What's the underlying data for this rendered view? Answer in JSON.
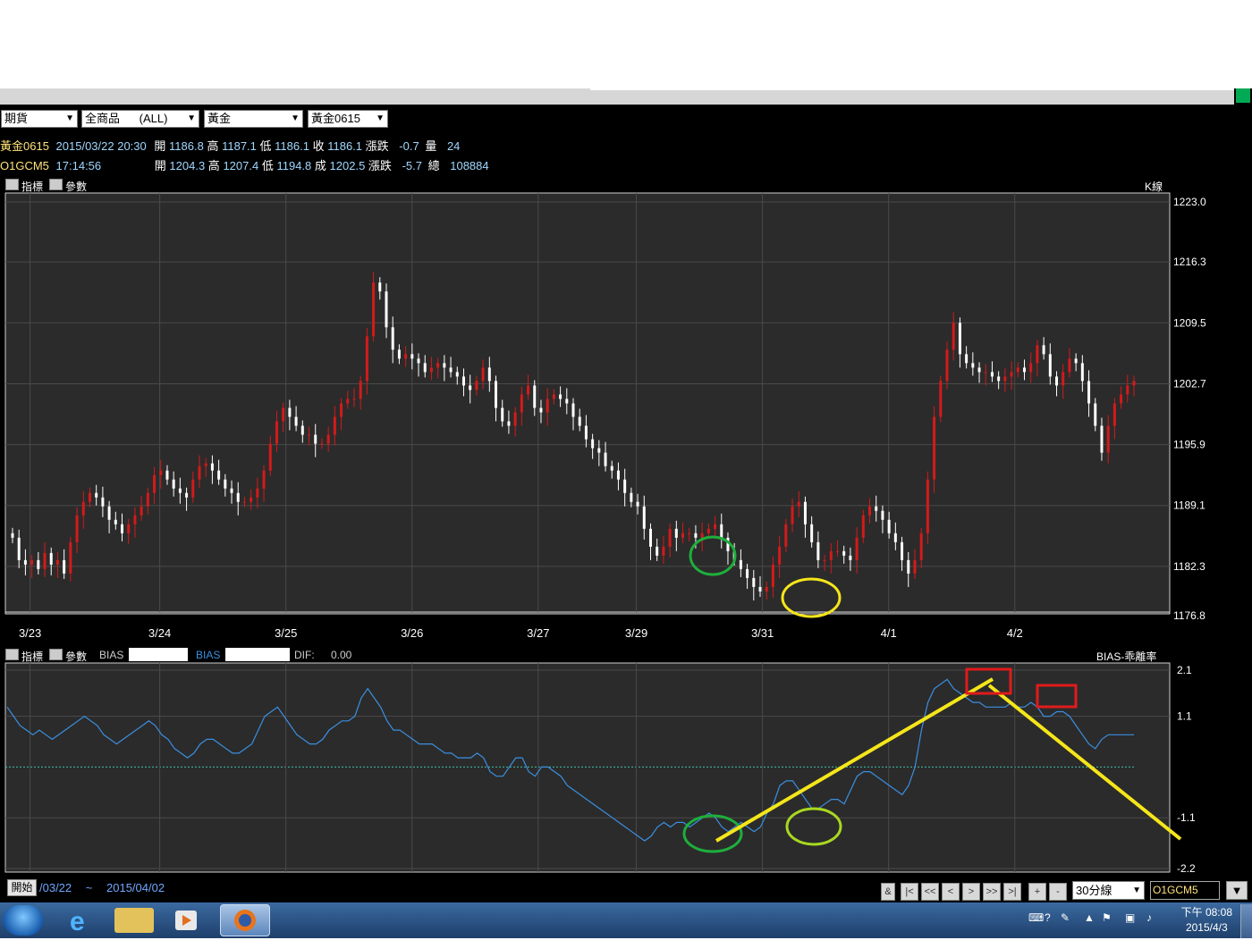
{
  "toolbar": {
    "market_select": "期貨",
    "product_select": "全商品      (ALL)",
    "category_select": "黃金",
    "contract_select": "黃金0615"
  },
  "quote1": {
    "name": "黃金0615",
    "datetime": "2015/03/22 20:30",
    "open_label": "開",
    "open": "1186.8",
    "high_label": "高",
    "high": "1187.1",
    "low_label": "低",
    "low": "1186.1",
    "close_label": "收",
    "close": "1186.1",
    "change_label": "漲跌",
    "change": "-0.7",
    "vol_label": "量",
    "vol": "24"
  },
  "quote2": {
    "name": "O1GCM5",
    "time": "17:14:56",
    "open_label": "開",
    "open": "1204.3",
    "high_label": "高",
    "high": "1207.4",
    "low_label": "低",
    "low": "1194.8",
    "last_label": "成",
    "last": "1202.5",
    "change_label": "漲跌",
    "change": "-5.7",
    "vol_label": "總",
    "vol": "108884"
  },
  "panel1": {
    "indicator_label": "指標",
    "param_label": "參數",
    "type_label": "K線"
  },
  "panel2": {
    "indicator_label": "指標",
    "param_label": "參數",
    "bias1_label": "BIAS",
    "bias2_label": "BIAS",
    "dif_label": "DIF:",
    "dif_value": "0.00",
    "type_label": "BIAS-乖離率"
  },
  "footer": {
    "start_button": "開始",
    "range_start": "/03/22",
    "range_sep": "~",
    "range_end": "2015/04/02",
    "amp": "&",
    "first": "|<",
    "prev_page": "<<",
    "prev": "<",
    "next": ">",
    "next_page": ">>",
    "last": ">|",
    "zoom_in": "+",
    "zoom_out": "-",
    "period_select": "30分線",
    "symbol_input": "O1GCM5",
    "dropdown": "▼"
  },
  "taskbar": {
    "clock_time": "下午 08:08",
    "clock_date": "2015/4/3"
  },
  "colors": {
    "up": "#d41a1a",
    "down": "#ffffff",
    "bias": "#3a8fe0",
    "grid": "#4a4a4a",
    "annotation_yellow": "#f5e61a",
    "annotation_green": "#1eae3c",
    "annotation_red": "#e01b1b"
  },
  "chart_data": [
    {
      "type": "candlestick",
      "y_ticks": [
        "1223.0",
        "1216.3",
        "1209.5",
        "1202.7",
        "1195.9",
        "1189.1",
        "1182.3",
        "1176.8"
      ],
      "ylim": [
        1176.8,
        1223.0
      ],
      "x_date_labels": [
        "3/23",
        "3/24",
        "3/25",
        "3/26",
        "3/27",
        "3/29",
        "3/31",
        "4/1",
        "4/2"
      ],
      "closes": [
        1185.5,
        1183.0,
        1182.5,
        1183.0,
        1182.0,
        1183.8,
        1182.5,
        1183.0,
        1181.5,
        1185.0,
        1188.0,
        1189.5,
        1190.5,
        1190.0,
        1189.0,
        1187.5,
        1187.0,
        1186.0,
        1187.0,
        1188.0,
        1189.0,
        1190.5,
        1192.5,
        1193.0,
        1192.0,
        1191.0,
        1190.5,
        1190.0,
        1192.0,
        1193.5,
        1193.8,
        1193.0,
        1192.0,
        1191.0,
        1190.5,
        1189.5,
        1189.5,
        1190.0,
        1191.0,
        1193.0,
        1196.0,
        1198.5,
        1200.0,
        1199.0,
        1198.0,
        1197.0,
        1197.0,
        1196.0,
        1196.0,
        1197.0,
        1199.0,
        1200.5,
        1201.0,
        1201.0,
        1203.0,
        1208.0,
        1214.0,
        1213.0,
        1209.0,
        1206.5,
        1205.5,
        1206.0,
        1205.5,
        1205.0,
        1204.0,
        1204.5,
        1205.0,
        1204.5,
        1204.0,
        1203.5,
        1202.5,
        1202.0,
        1203.0,
        1204.5,
        1203.0,
        1200.0,
        1198.5,
        1198.0,
        1199.5,
        1201.5,
        1202.5,
        1200.0,
        1199.5,
        1201.0,
        1201.5,
        1201.0,
        1200.5,
        1199.0,
        1198.0,
        1196.5,
        1195.5,
        1195.0,
        1193.5,
        1193.0,
        1192.0,
        1190.5,
        1189.5,
        1189.0,
        1186.5,
        1184.5,
        1183.5,
        1184.5,
        1186.5,
        1185.5,
        1186.0,
        1186.0,
        1185.5,
        1186.0,
        1186.5,
        1187.0,
        1185.5,
        1184.0,
        1183.0,
        1182.0,
        1181.0,
        1180.0,
        1179.5,
        1180.0,
        1182.5,
        1184.5,
        1187.0,
        1189.0,
        1189.5,
        1187.0,
        1185.0,
        1183.0,
        1183.0,
        1184.0,
        1184.0,
        1183.5,
        1183.0,
        1185.5,
        1188.0,
        1189.0,
        1188.5,
        1187.5,
        1186.0,
        1185.0,
        1183.0,
        1181.5,
        1183.0,
        1186.0,
        1192.0,
        1199.0,
        1203.0,
        1206.5,
        1209.5,
        1206.0,
        1205.0,
        1204.5,
        1204.0,
        1204.0,
        1203.5,
        1203.0,
        1203.5,
        1204.0,
        1204.5,
        1204.0,
        1205.0,
        1207.0,
        1206.0,
        1203.5,
        1202.5,
        1204.0,
        1205.5,
        1205.0,
        1203.0,
        1200.5,
        1198.0,
        1195.0,
        1198.0,
        1200.5,
        1201.5,
        1202.5,
        1203.0
      ]
    },
    {
      "type": "line",
      "name": "BIAS",
      "y_ticks": [
        "2.1",
        "1.1",
        "-1.1",
        "-2.2"
      ],
      "ylim": [
        -2.2,
        2.1
      ],
      "values": [
        1.3,
        1.1,
        0.9,
        0.8,
        0.7,
        0.8,
        0.7,
        0.6,
        0.7,
        0.8,
        0.9,
        1.0,
        1.1,
        1.0,
        0.9,
        0.7,
        0.6,
        0.5,
        0.6,
        0.7,
        0.8,
        0.9,
        1.0,
        0.9,
        0.7,
        0.6,
        0.4,
        0.3,
        0.2,
        0.3,
        0.5,
        0.6,
        0.6,
        0.5,
        0.4,
        0.3,
        0.3,
        0.4,
        0.5,
        0.8,
        1.1,
        1.2,
        1.3,
        1.1,
        0.9,
        0.7,
        0.6,
        0.5,
        0.5,
        0.6,
        0.8,
        0.9,
        1.0,
        1.0,
        1.1,
        1.5,
        1.7,
        1.5,
        1.3,
        1.0,
        0.8,
        0.8,
        0.7,
        0.6,
        0.5,
        0.5,
        0.5,
        0.4,
        0.3,
        0.3,
        0.2,
        0.2,
        0.2,
        0.3,
        0.2,
        -0.1,
        -0.2,
        -0.2,
        0.0,
        0.2,
        0.2,
        -0.1,
        -0.2,
        0.0,
        0.0,
        -0.1,
        -0.2,
        -0.4,
        -0.5,
        -0.6,
        -0.7,
        -0.8,
        -0.9,
        -1.0,
        -1.1,
        -1.2,
        -1.3,
        -1.4,
        -1.5,
        -1.6,
        -1.5,
        -1.3,
        -1.2,
        -1.3,
        -1.2,
        -1.2,
        -1.3,
        -1.2,
        -1.1,
        -1.0,
        -1.1,
        -1.3,
        -1.4,
        -1.3,
        -1.2,
        -1.3,
        -1.4,
        -1.3,
        -1.0,
        -0.8,
        -0.4,
        -0.3,
        -0.3,
        -0.5,
        -0.7,
        -0.9,
        -0.9,
        -0.8,
        -0.7,
        -0.7,
        -0.8,
        -0.5,
        -0.2,
        -0.1,
        -0.1,
        -0.2,
        -0.3,
        -0.4,
        -0.5,
        -0.6,
        -0.4,
        0.0,
        0.8,
        1.4,
        1.7,
        1.8,
        1.9,
        1.7,
        1.6,
        1.5,
        1.4,
        1.4,
        1.3,
        1.3,
        1.3,
        1.3,
        1.4,
        1.3,
        1.3,
        1.4,
        1.3,
        1.1,
        1.1,
        1.2,
        1.2,
        1.1,
        0.9,
        0.7,
        0.5,
        0.4,
        0.6,
        0.7,
        0.7,
        0.7,
        0.7,
        0.7
      ]
    }
  ]
}
